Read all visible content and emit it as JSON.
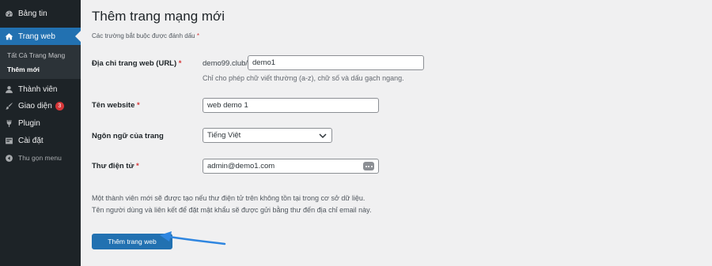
{
  "sidebar": {
    "items": [
      {
        "label": "Bảng tin",
        "icon": "dashboard-icon"
      },
      {
        "label": "Trang web",
        "icon": "home-icon",
        "active": true
      },
      {
        "label": "Thành viên",
        "icon": "user-icon"
      },
      {
        "label": "Giao diện",
        "icon": "brush-icon",
        "badge": "3"
      },
      {
        "label": "Plugin",
        "icon": "plugin-icon"
      },
      {
        "label": "Cài đặt",
        "icon": "settings-icon"
      },
      {
        "label": "Thu gọn menu",
        "icon": "collapse-icon"
      }
    ],
    "submenu": [
      {
        "label": "Tất Cả Trang Mạng"
      },
      {
        "label": "Thêm mới",
        "current": true
      }
    ]
  },
  "main": {
    "title": "Thêm trang mạng mới",
    "required_note": "Các trường bắt buộc được đánh dấu",
    "required_mark": "*",
    "fields": {
      "address": {
        "label": "Địa chỉ trang web (URL)",
        "prefix": "demo99.club/",
        "value": "demo1",
        "description": "Chỉ cho phép chữ viết thường (a-z), chữ số và dấu gạch ngang."
      },
      "site_title": {
        "label": "Tên website",
        "value": "web demo 1"
      },
      "language": {
        "label": "Ngôn ngữ của trang",
        "value": "Tiếng Việt"
      },
      "email": {
        "label": "Thư điện tử",
        "value": "admin@demo1.com"
      }
    },
    "notice_line1": "Một thành viên mới sẽ được tạo nếu thư điện tử trên không tồn tại trong cơ sở dữ liệu.",
    "notice_line2": "Tên người dùng và liên kết để đặt mật khẩu sẽ được gửi bằng thư đến địa chỉ email này.",
    "submit_label": "Thêm trang web"
  },
  "colors": {
    "accent": "#2271b1",
    "sidebar_bg": "#1d2327",
    "annotation_arrow": "#2f86e0",
    "badge": "#d63638"
  }
}
